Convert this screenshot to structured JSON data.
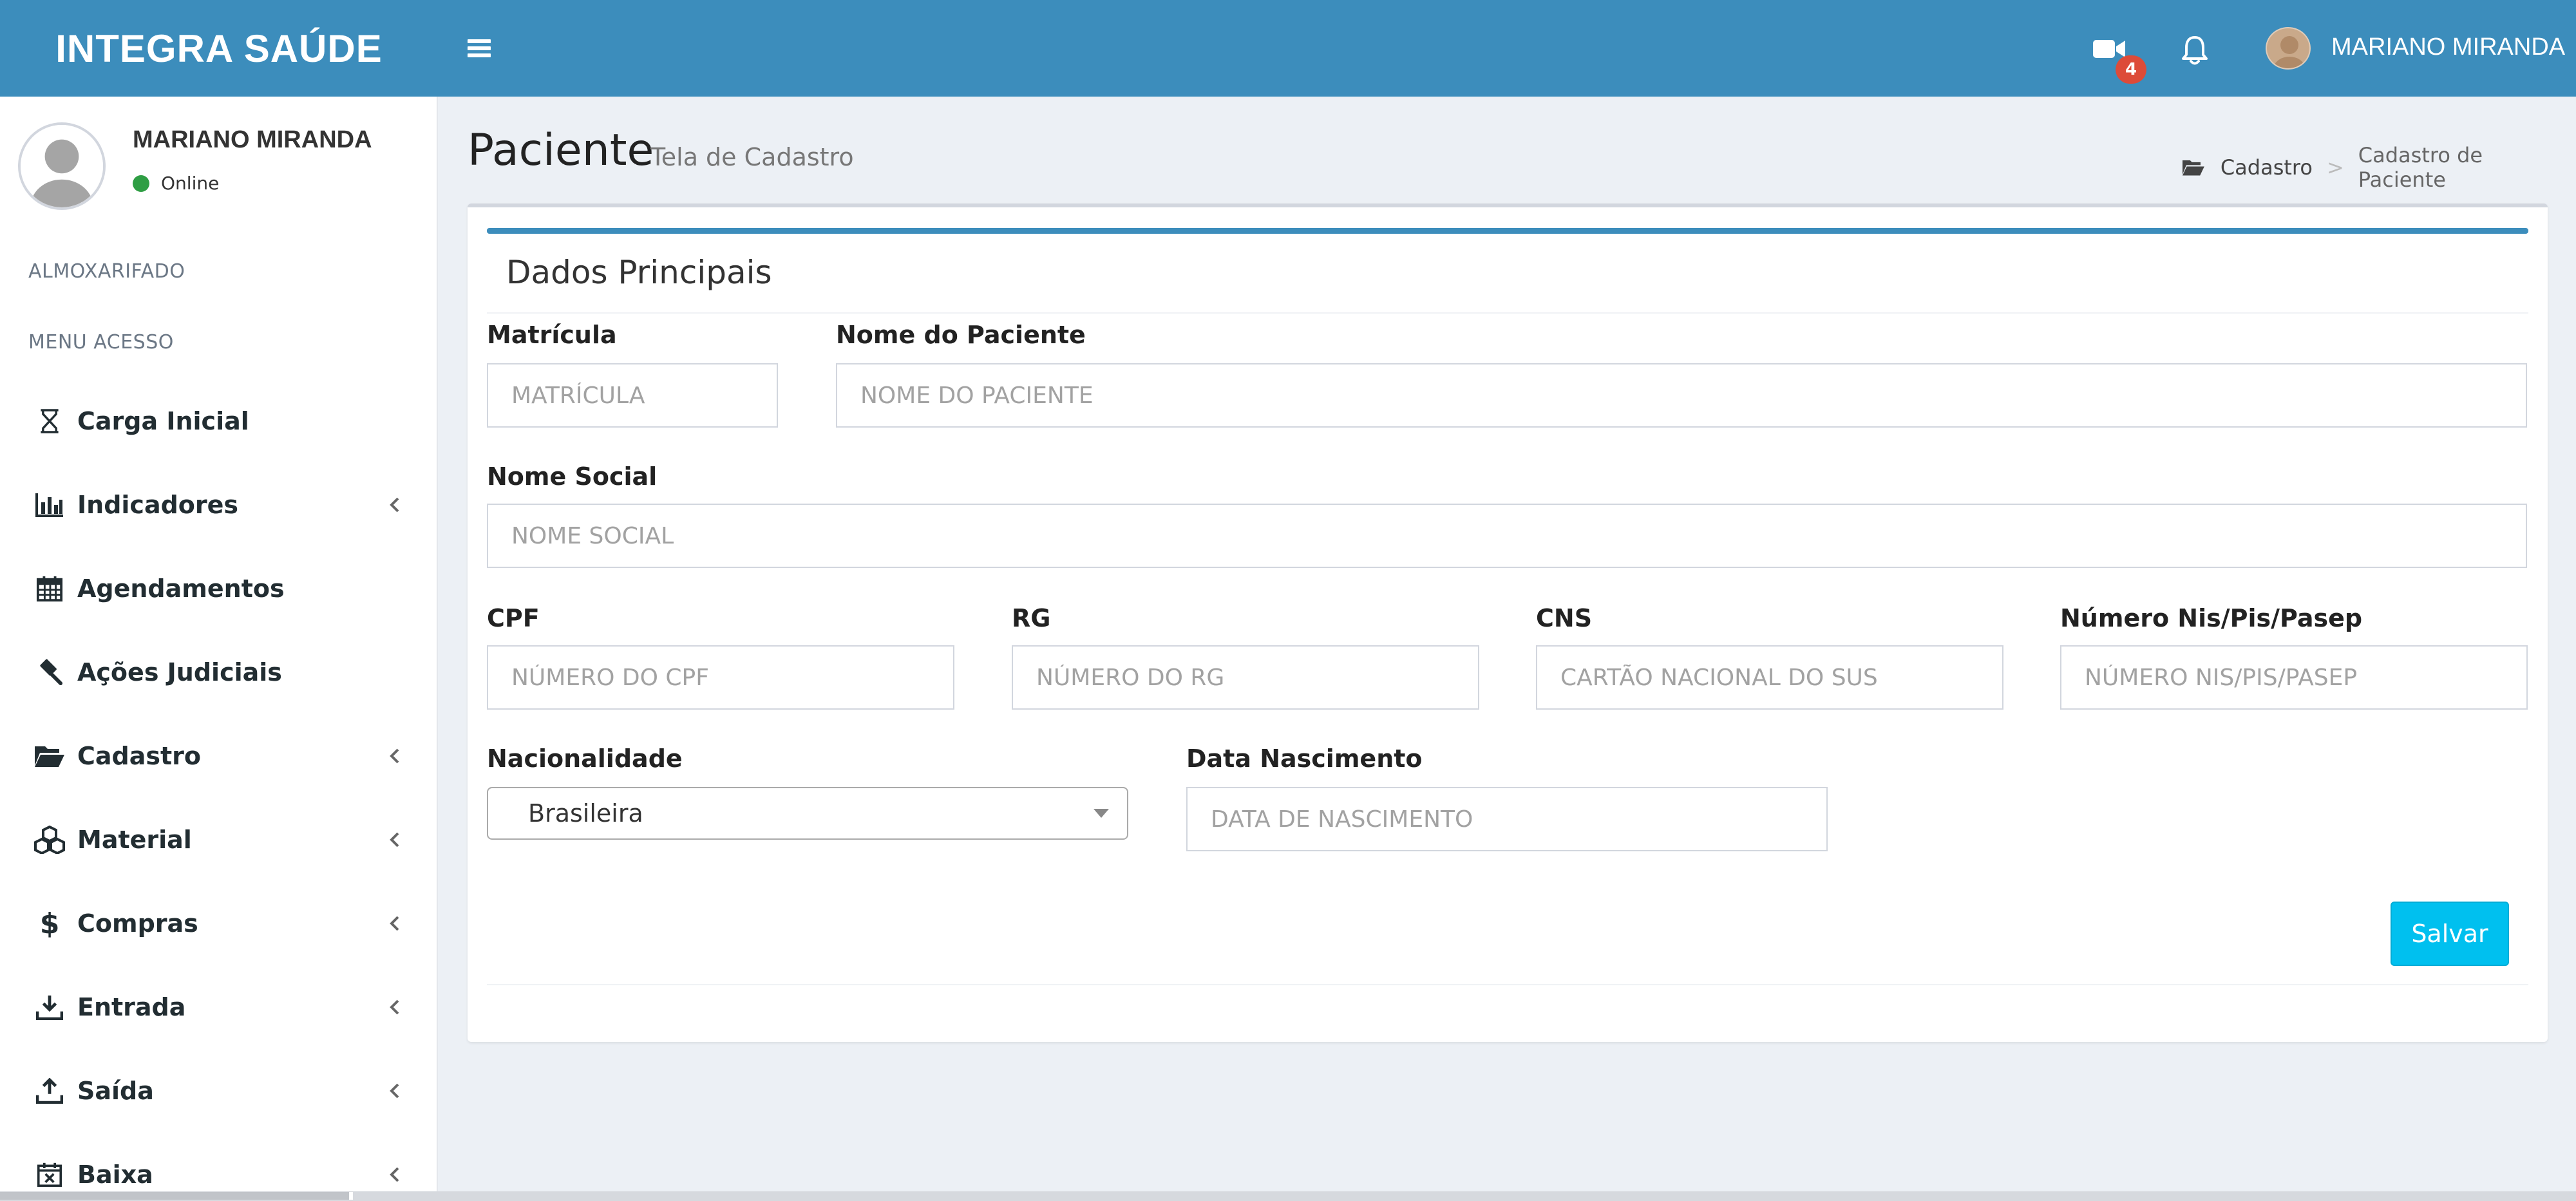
{
  "header": {
    "logo": "INTEGRA SAÚDE",
    "video_badge": "4",
    "user_name": "MARIANO MIRANDA"
  },
  "sidebar": {
    "user_name": "MARIANO MIRANDA",
    "status": "Online",
    "headers": [
      "ALMOXARIFADO",
      "MENU ACESSO"
    ],
    "items": [
      {
        "label": "Carga Inicial",
        "icon": "hourglass-icon",
        "has_children": false
      },
      {
        "label": "Indicadores",
        "icon": "bar-chart-icon",
        "has_children": true
      },
      {
        "label": "Agendamentos",
        "icon": "calendar-icon",
        "has_children": false
      },
      {
        "label": "Ações Judiciais",
        "icon": "gavel-icon",
        "has_children": false
      },
      {
        "label": "Cadastro",
        "icon": "folder-open-icon",
        "has_children": true
      },
      {
        "label": "Material",
        "icon": "cubes-icon",
        "has_children": true
      },
      {
        "label": "Compras",
        "icon": "dollar-icon",
        "has_children": true
      },
      {
        "label": "Entrada",
        "icon": "download-icon",
        "has_children": true
      },
      {
        "label": "Saída",
        "icon": "upload-icon",
        "has_children": true
      },
      {
        "label": "Baixa",
        "icon": "calendar-times-icon",
        "has_children": true
      }
    ]
  },
  "page": {
    "title": "Paciente",
    "subtitle": "Tela de Cadastro",
    "breadcrumb": [
      "Cadastro",
      "Cadastro de Paciente"
    ]
  },
  "form": {
    "section_title": "Dados Principais",
    "fields": {
      "matricula": {
        "label": "Matrícula",
        "placeholder": "MATRÍCULA"
      },
      "nome": {
        "label": "Nome do Paciente",
        "placeholder": "NOME DO PACIENTE"
      },
      "nome_social": {
        "label": "Nome Social",
        "placeholder": "NOME SOCIAL"
      },
      "cpf": {
        "label": "CPF",
        "placeholder": "NÚMERO DO CPF"
      },
      "rg": {
        "label": "RG",
        "placeholder": "NÚMERO DO RG"
      },
      "cns": {
        "label": "CNS",
        "placeholder": "CARTÃO NACIONAL DO SUS"
      },
      "nis": {
        "label": "Número Nis/Pis/Pasep",
        "placeholder": "NÚMERO NIS/PIS/PASEP"
      },
      "nacionalidade": {
        "label": "Nacionalidade",
        "value": "Brasileira"
      },
      "nascimento": {
        "label": "Data Nascimento",
        "placeholder": "DATA DE NASCIMENTO"
      }
    },
    "save_label": "Salvar"
  },
  "colors": {
    "brand": "#3c8dbc",
    "button": "#00c0ef",
    "badge": "#dd4b39",
    "online": "#2f9e44"
  }
}
